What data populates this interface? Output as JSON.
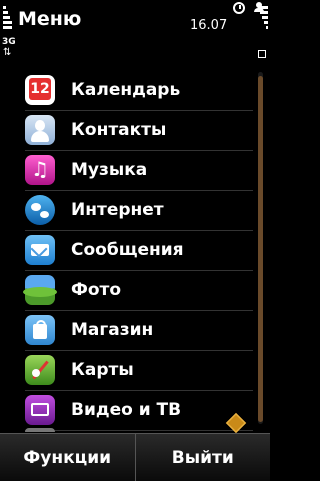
{
  "status_bar": {
    "title": "Меню",
    "time": "16.07",
    "network_type": "3G",
    "arrows": "⇅",
    "alarm_icon": "alarm-clock-icon",
    "profile_icon": "person-icon"
  },
  "menu": {
    "items": [
      {
        "label": "Календарь",
        "icon": "calendar-icon",
        "icon_text": "12",
        "color": "#e53030"
      },
      {
        "label": "Контакты",
        "icon": "contacts-icon",
        "color": "#8fb0d6"
      },
      {
        "label": "Музыка",
        "icon": "music-icon",
        "icon_text": "♫",
        "color": "#d22bb0"
      },
      {
        "label": "Интернет",
        "icon": "globe-icon",
        "color": "#1a7ec8"
      },
      {
        "label": "Сообщения",
        "icon": "envelope-icon",
        "color": "#2f8ee0"
      },
      {
        "label": "Фото",
        "icon": "photo-icon",
        "color": "#4c9a2a"
      },
      {
        "label": "Магазин",
        "icon": "shopping-bag-icon",
        "color": "#2f86cf"
      },
      {
        "label": "Карты",
        "icon": "map-icon",
        "color": "#3d8b1c"
      },
      {
        "label": "Видео и ТВ",
        "icon": "tv-icon",
        "color": "#8a2ab0"
      }
    ]
  },
  "softkeys": {
    "left": "Функции",
    "right": "Выйти"
  },
  "colors": {
    "background": "#000000",
    "scroll_thumb": "#6a4a2a",
    "divider": "#333333"
  }
}
